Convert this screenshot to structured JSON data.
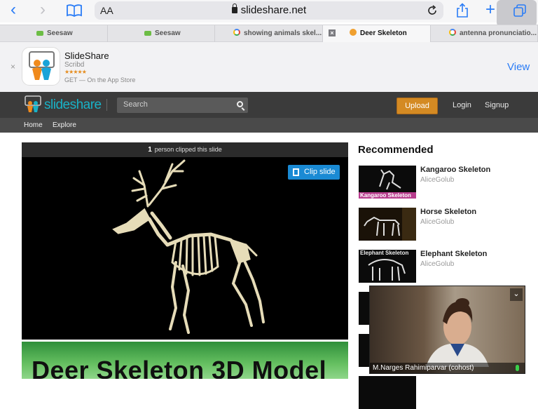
{
  "browser": {
    "aa_label": "AA",
    "url": "slideshare.net",
    "tabs": [
      {
        "label": "Seesaw",
        "favicon": "seesaw-favicon"
      },
      {
        "label": "Seesaw",
        "favicon": "seesaw-favicon"
      },
      {
        "label": "showing animals skel...",
        "favicon": "google-favicon"
      },
      {
        "label": "Deer Skeleton",
        "favicon": "slideshare-favicon",
        "active": true
      },
      {
        "label": "antenna pronunciatio...",
        "favicon": "google-favicon"
      }
    ]
  },
  "app_banner": {
    "close": "×",
    "name": "SlideShare",
    "publisher": "Scribd",
    "stars": "★★★★★",
    "rating": 4.5,
    "get_text": "GET — On the App Store",
    "view_label": "View"
  },
  "site_header": {
    "logo_text": "slideshare",
    "search_placeholder": "Search",
    "upload_label": "Upload",
    "login_label": "Login",
    "signup_label": "Signup",
    "nav": [
      "Home",
      "Explore"
    ]
  },
  "slide_viewer": {
    "clip_count": "1",
    "clip_text": "person clipped this slide",
    "clip_button": "Clip slide",
    "next_slide_title": "Deer Skeleton 3D Model"
  },
  "recommended": {
    "heading": "Recommended",
    "items": [
      {
        "title": "Kangaroo Skeleton",
        "author": "AliceGolub",
        "thumb_caption": "Kangaroo Skeleton"
      },
      {
        "title": "Horse Skeleton",
        "author": "AliceGolub",
        "thumb_caption": ""
      },
      {
        "title": "Elephant Skeleton",
        "author": "AliceGolub",
        "thumb_caption": "Elephant Skeleton"
      }
    ]
  },
  "video_call": {
    "participant": "M.Narges Rahimiparvar (cohost)"
  },
  "colors": {
    "accent_blue": "#2a7cf6",
    "slideshare_teal": "#19b1c6",
    "upload_orange": "#d48a23",
    "clip_blue": "#1a8ad4"
  }
}
